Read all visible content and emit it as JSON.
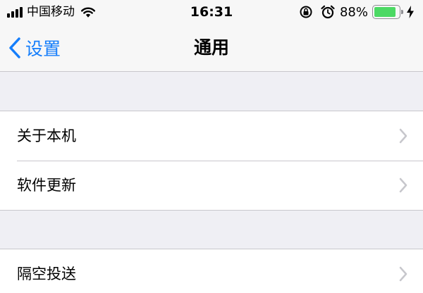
{
  "statusbar": {
    "carrier": "中国移动",
    "time": "16:31",
    "battery_percent_text": "88%",
    "battery_level": 0.88,
    "icons": [
      "signal-icon",
      "wifi-icon",
      "rotation-lock-icon",
      "alarm-icon",
      "battery-icon",
      "charging-bolt-icon"
    ],
    "colors": {
      "battery_fill": "#4cd964"
    }
  },
  "navbar": {
    "back_label": "设置",
    "title": "通用",
    "colors": {
      "tint": "#157efb"
    }
  },
  "groups": [
    {
      "items": [
        {
          "label": "关于本机"
        },
        {
          "label": "软件更新"
        }
      ]
    },
    {
      "items": [
        {
          "label": "隔空投送"
        }
      ]
    }
  ]
}
